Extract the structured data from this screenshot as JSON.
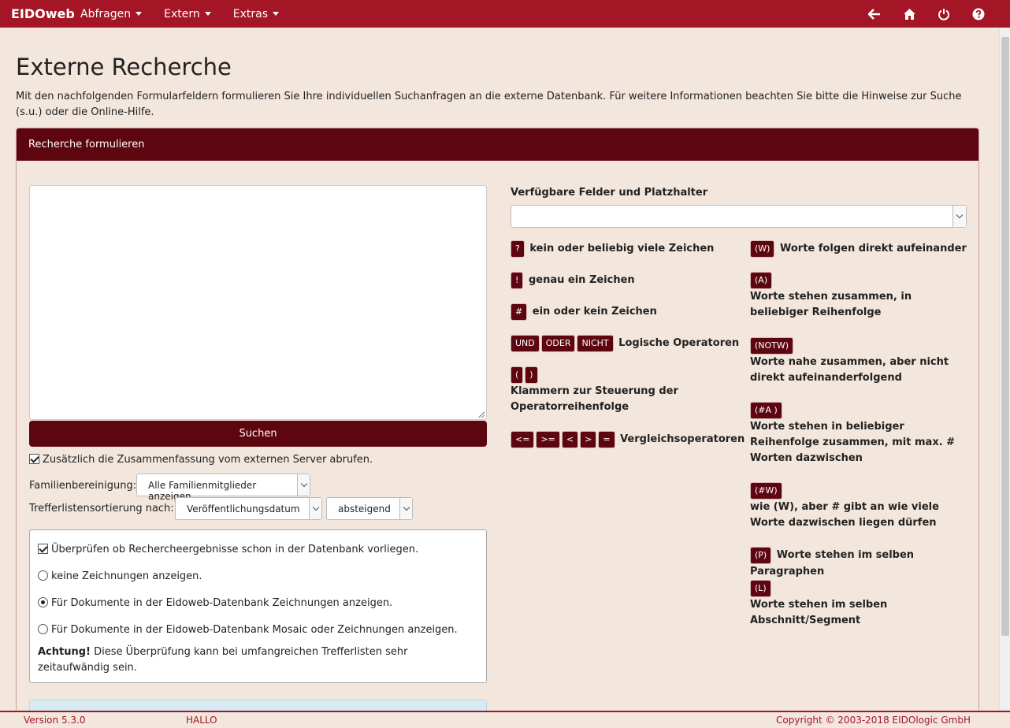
{
  "navbar": {
    "brand": "EIDOweb",
    "menus": [
      {
        "label": "Abfragen"
      },
      {
        "label": "Extern"
      },
      {
        "label": "Extras"
      }
    ],
    "icons": [
      "arrow-left-icon",
      "home-icon",
      "power-icon",
      "help-icon"
    ]
  },
  "page": {
    "title": "Externe Recherche",
    "intro": "Mit den nachfolgenden Formularfeldern formulieren Sie Ihre individuellen Suchanfragen an die externe Datenbank. Für weitere Informationen beachten Sie bitte die Hinweise zur Suche (s.u.) oder die Online-Hilfe."
  },
  "panel": {
    "heading": "Recherche formulieren",
    "search_button": "Suchen",
    "summary_checkbox": "Zusätzlich die Zusammenfassung vom externen Server abrufen.",
    "family_label": "Familienbereinigung:",
    "family_value": "Alle Familienmitglieder anzeigen",
    "sort_label": "Trefferlistensortierung nach:",
    "sort_value": "Veröffentlichungsdatum",
    "order_value": "absteigend",
    "check_db": "Überprüfen ob Rechercheergebnisse schon in der Datenbank vorliegen.",
    "radio_none": "keine Zeichnungen anzeigen.",
    "radio_drawings": "Für Dokumente in der Eidoweb-Datenbank Zeichnungen anzeigen.",
    "radio_mosaic": "Für Dokumente in der Eidoweb-Datenbank Mosaic oder Zeichnungen anzeigen.",
    "note_bold": "Achtung!",
    "note_text": " Diese Überprüfung kann bei umfangreichen Trefferlisten sehr zeitaufwändig sein."
  },
  "help": {
    "fields_label": "Verfügbare Felder und Platzhalter",
    "left": [
      {
        "tags": [
          "?"
        ],
        "text": "kein oder beliebig viele Zeichen"
      },
      {
        "tags": [
          "!"
        ],
        "text": "genau ein Zeichen"
      },
      {
        "tags": [
          "#"
        ],
        "text": "ein oder kein Zeichen"
      },
      {
        "tags": [
          "UND",
          "ODER",
          "NICHT"
        ],
        "text": "Logische Operatoren"
      },
      {
        "tags": [
          "(",
          ")"
        ],
        "text": "Klammern zur Steuerung der Operatorreihenfolge"
      },
      {
        "tags": [
          "<=",
          ">=",
          "<",
          ">",
          "="
        ],
        "text": "Vergleichsoperatoren"
      }
    ],
    "right": [
      {
        "tags": [
          "(W)"
        ],
        "text": "Worte folgen direkt aufeinander"
      },
      {
        "tags": [
          "(A)"
        ],
        "text": "Worte stehen zusammen, in beliebiger Reihenfolge"
      },
      {
        "tags": [
          "(NOTW)"
        ],
        "text": "Worte nahe zusammen, aber nicht direkt aufeinanderfolgend"
      },
      {
        "tags": [
          "(#A )"
        ],
        "text": "Worte stehen in beliebiger Reihenfolge zusammen, mit max. # Worten dazwischen"
      },
      {
        "tags": [
          "(#W)"
        ],
        "text": "wie (W), aber # gibt an wie viele Worte dazwischen liegen dürfen"
      },
      {
        "tags": [
          "(P)"
        ],
        "text": "Worte stehen im selben Paragraphen"
      },
      {
        "tags": [
          "(L)"
        ],
        "text": "Worte stehen im selben Abschnitt/Segment"
      }
    ]
  },
  "footer": {
    "version": "Version 5.3.0",
    "user": "HALLO",
    "copyright": "Copyright © 2003-2018 EIDOlogic GmbH"
  },
  "colors": {
    "navbar": "#a41626",
    "panel_header": "#5e0610",
    "background": "#f2e6dd"
  }
}
